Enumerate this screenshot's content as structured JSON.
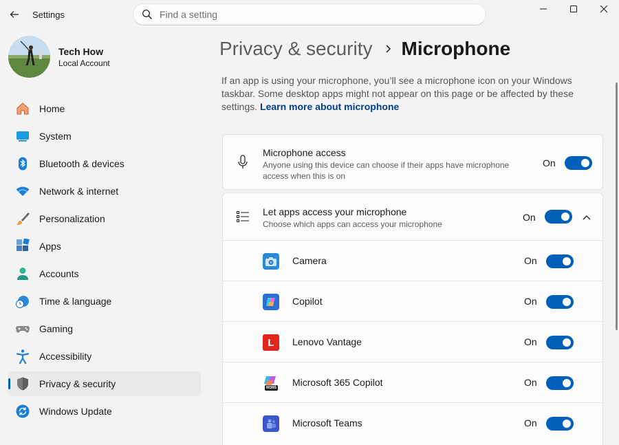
{
  "titlebar": {
    "app_title": "Settings",
    "search_placeholder": "Find a setting"
  },
  "profile": {
    "name": "Tech How",
    "account_type": "Local Account"
  },
  "sidebar": {
    "items": [
      {
        "label": "Home",
        "icon": "home-icon"
      },
      {
        "label": "System",
        "icon": "system-icon"
      },
      {
        "label": "Bluetooth & devices",
        "icon": "bluetooth-icon"
      },
      {
        "label": "Network & internet",
        "icon": "wifi-icon"
      },
      {
        "label": "Personalization",
        "icon": "brush-icon"
      },
      {
        "label": "Apps",
        "icon": "apps-icon"
      },
      {
        "label": "Accounts",
        "icon": "accounts-icon"
      },
      {
        "label": "Time & language",
        "icon": "clock-globe-icon"
      },
      {
        "label": "Gaming",
        "icon": "gamepad-icon"
      },
      {
        "label": "Accessibility",
        "icon": "accessibility-icon"
      },
      {
        "label": "Privacy & security",
        "icon": "shield-icon",
        "active": true
      },
      {
        "label": "Windows Update",
        "icon": "update-icon"
      }
    ]
  },
  "breadcrumb": {
    "parent": "Privacy & security",
    "current": "Microphone"
  },
  "description": {
    "text": "If an app is using your microphone, you’ll see a microphone icon on your Windows taskbar. Some desktop apps might not appear on this page or be affected by these settings.",
    "link": "Learn more about microphone"
  },
  "microphone_access": {
    "title": "Microphone access",
    "subtitle": "Anyone using this device can choose if their apps have microphone access when this is on",
    "state_label": "On",
    "enabled": true
  },
  "apps_access": {
    "title": "Let apps access your microphone",
    "subtitle": "Choose which apps can access your microphone",
    "state_label": "On",
    "enabled": true,
    "expanded": true,
    "apps": [
      {
        "name": "Camera",
        "state_label": "On",
        "enabled": true,
        "icon": "camera-app-icon"
      },
      {
        "name": "Copilot",
        "state_label": "On",
        "enabled": true,
        "icon": "copilot-app-icon"
      },
      {
        "name": "Lenovo Vantage",
        "state_label": "On",
        "enabled": true,
        "icon": "lenovo-vantage-app-icon",
        "icon_letter": "L"
      },
      {
        "name": "Microsoft 365 Copilot",
        "state_label": "On",
        "enabled": true,
        "icon": "m365-copilot-app-icon",
        "icon_badge": "M365"
      },
      {
        "name": "Microsoft Teams",
        "state_label": "On",
        "enabled": true,
        "icon": "teams-app-icon"
      }
    ]
  },
  "colors": {
    "accent": "#005fb8",
    "link": "#003e92",
    "background": "#f3f3f3",
    "card": "#fbfbfb"
  }
}
